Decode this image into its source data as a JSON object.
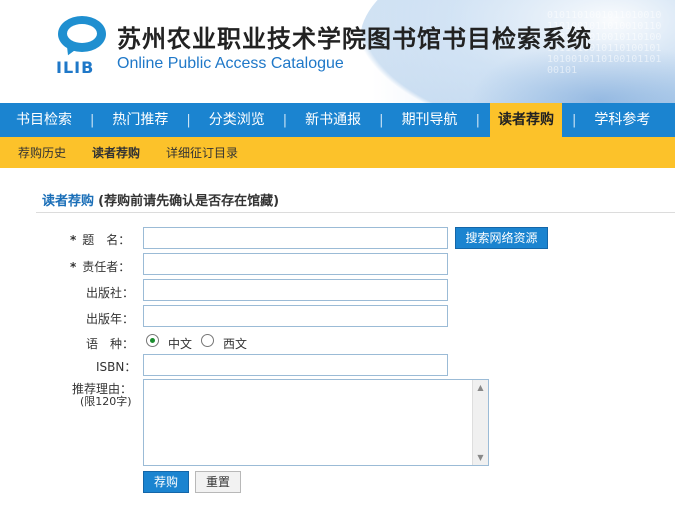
{
  "header": {
    "logo_text": "ILIB",
    "title": "苏州农业职业技术学院图书馆书目检索系统",
    "subtitle": "Online Public Access Catalogue"
  },
  "main_nav": {
    "items": [
      "书目检索",
      "热门推荐",
      "分类浏览",
      "新书通报",
      "期刊导航",
      "读者荐购",
      "学科参考"
    ],
    "active": "读者荐购"
  },
  "sub_nav": {
    "items": [
      "荐购历史",
      "读者荐购",
      "详细征订目录"
    ],
    "active": "读者荐购"
  },
  "form": {
    "section_title": "读者荐购",
    "section_note": "(荐购前请先确认是否存在馆藏)",
    "required_mark": "*",
    "labels": {
      "title": "题　名：",
      "author": "责任者：",
      "publisher": "出版社：",
      "year": "出版年：",
      "language": "语　种：",
      "isbn": "ISBN：",
      "reason": "推荐理由：",
      "reason_limit": "(限120字)"
    },
    "values": {
      "title": "",
      "author": "",
      "publisher": "",
      "year": "",
      "isbn": "",
      "reason": ""
    },
    "language_options": [
      "中文",
      "西文"
    ],
    "language_selected": "中文",
    "search_button": "搜索网络资源",
    "submit_button": "荐购",
    "reset_button": "重置"
  },
  "colors": {
    "nav_blue": "#1b84d0",
    "accent_yellow": "#fcc22a",
    "link_blue": "#1b6fb8"
  }
}
